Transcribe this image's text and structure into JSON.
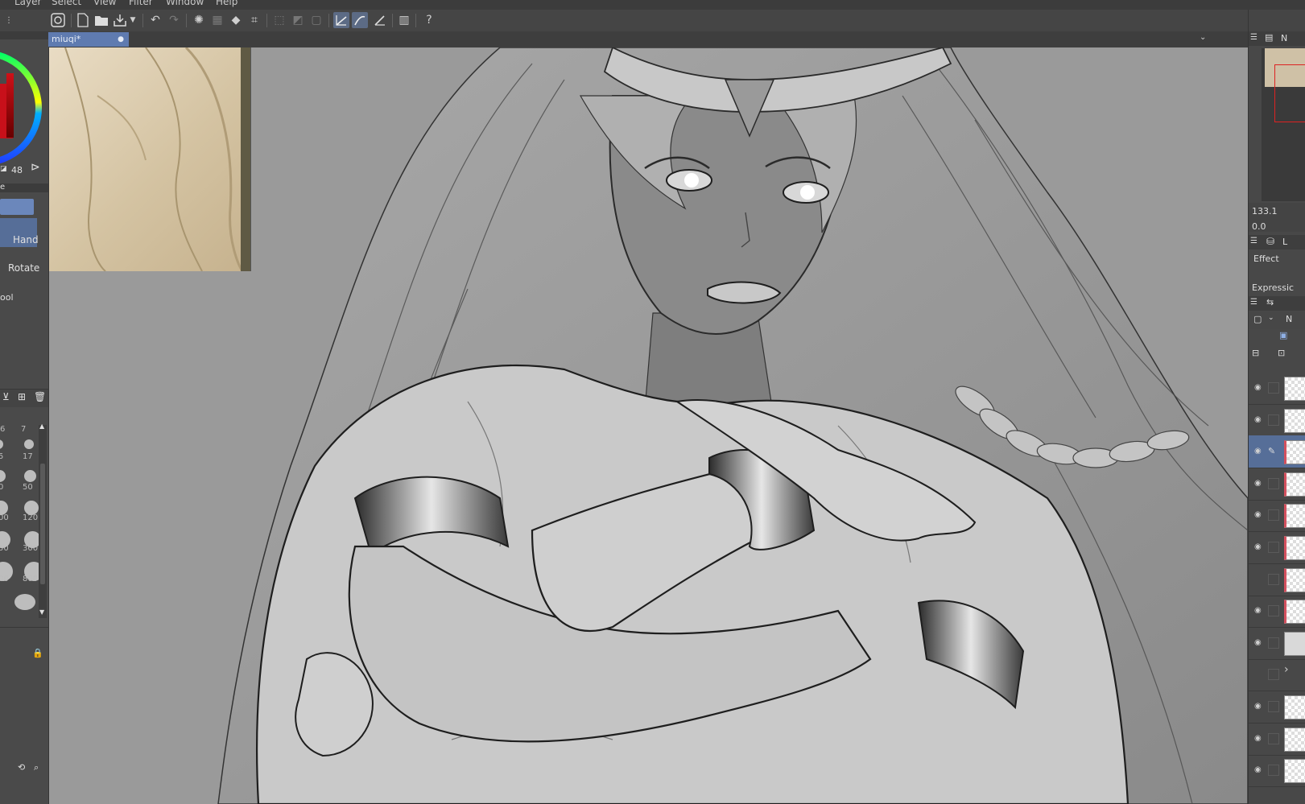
{
  "menu": [
    "Layer",
    "Select",
    "View",
    "Filter",
    "Window",
    "Help"
  ],
  "document": {
    "tab_label": "miuqi*",
    "tab_modified_mark": "●"
  },
  "left_panel": {
    "brush_size_value": "48",
    "tool_labels": {
      "hand": "Hand",
      "rotate": "Rotate",
      "tool_partial": "ool",
      "tab_partial": "e"
    },
    "brush_size_columns": [
      "6",
      "7"
    ],
    "brush_sizes": [
      [
        "5",
        "17"
      ],
      [
        "0",
        "50"
      ],
      [
        "00",
        "120"
      ],
      [
        "50",
        "300"
      ],
      [
        "00",
        "800"
      ]
    ]
  },
  "right_panel": {
    "zoom_value": "133.1",
    "rotation_value": "0.0",
    "tab_partial": "N",
    "layer_tab_partial": "L",
    "blend_partial": "N",
    "effect_label": "Effect",
    "expression_label": "Expressic"
  },
  "layers": [
    {
      "visible": true,
      "pen": false,
      "thumb": "sketch",
      "color_mark": false
    },
    {
      "visible": true,
      "pen": false,
      "thumb": "sketch",
      "color_mark": false
    },
    {
      "visible": true,
      "pen": true,
      "thumb": "lines",
      "color_mark": true
    },
    {
      "visible": true,
      "pen": false,
      "thumb": "flat",
      "color_mark": true
    },
    {
      "visible": true,
      "pen": false,
      "thumb": "flat",
      "color_mark": true
    },
    {
      "visible": true,
      "pen": false,
      "thumb": "flat",
      "color_mark": true
    },
    {
      "visible": false,
      "pen": false,
      "thumb": "flat",
      "color_mark": true
    },
    {
      "visible": true,
      "pen": false,
      "thumb": "flat",
      "color_mark": true
    },
    {
      "visible": true,
      "pen": false,
      "thumb": "figure",
      "color_mark": false
    },
    {
      "visible": false,
      "pen": false,
      "thumb": "folder",
      "color_mark": false
    },
    {
      "visible": true,
      "pen": false,
      "thumb": "sketch",
      "color_mark": false
    },
    {
      "visible": true,
      "pen": false,
      "thumb": "flat",
      "color_mark": false
    },
    {
      "visible": true,
      "pen": false,
      "thumb": "flat",
      "color_mark": false
    }
  ],
  "colors": {
    "accent": "#5f7bb0",
    "canvas_bg": "#9a9a9a",
    "panel_bg": "#4a4a4a",
    "color_swatch": "#c8101a"
  }
}
